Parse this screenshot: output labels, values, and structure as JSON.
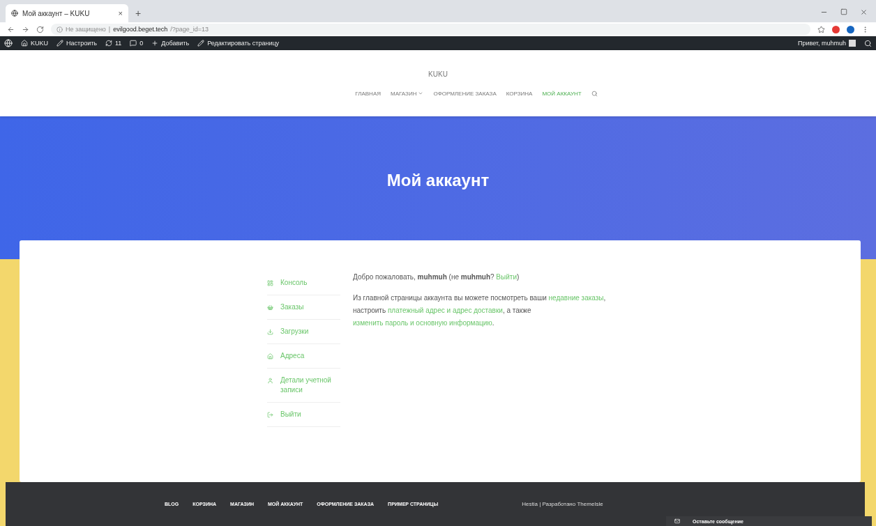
{
  "browser": {
    "tab_title": "Мой аккаунт – KUKU",
    "tab_close": "×",
    "new_tab": "+",
    "url_warning": "Не защищено",
    "url_separator": "|",
    "url_host": "evilgood.beget.tech",
    "url_path": "/?page_id=13"
  },
  "admin_bar": {
    "items": [
      {
        "kind": "site",
        "label": "KUKU"
      },
      {
        "kind": "customize",
        "label": "Настроить"
      },
      {
        "kind": "updates",
        "label": "11"
      },
      {
        "kind": "comments",
        "label": "0"
      },
      {
        "kind": "new",
        "label": "Добавить"
      },
      {
        "kind": "edit",
        "label": "Редактировать страницу"
      }
    ],
    "greeting": "Привет, muhmuh"
  },
  "site_title": "KUKU",
  "nav": [
    {
      "label": "ГЛАВНАЯ",
      "selected": false,
      "dropdown": false
    },
    {
      "label": "МАГАЗИН",
      "selected": false,
      "dropdown": true
    },
    {
      "label": "ОФОРМЛЕНИЕ ЗАКАЗА",
      "selected": false,
      "dropdown": false
    },
    {
      "label": "КОРЗИНА",
      "selected": false,
      "dropdown": false
    },
    {
      "label": "МОЙ АККАУНТ",
      "selected": true,
      "dropdown": false
    }
  ],
  "hero_title": "Мой аккаунт",
  "account_menu": [
    {
      "kind": "dashboard",
      "label": "Консоль"
    },
    {
      "kind": "orders",
      "label": "Заказы"
    },
    {
      "kind": "downloads",
      "label": "Загрузки"
    },
    {
      "kind": "addresses",
      "label": "Адреса"
    },
    {
      "kind": "account",
      "label": "Детали учетной записи"
    },
    {
      "kind": "logout",
      "label": "Выйти"
    }
  ],
  "welcome": [
    {
      "text": "Добро пожаловать, "
    },
    {
      "text": "muhmuh",
      "bold": true
    },
    {
      "text": " (не "
    },
    {
      "text": "muhmuh",
      "bold": true
    },
    {
      "text": "? "
    },
    {
      "text": "Выйти",
      "link": true
    },
    {
      "text": ")"
    }
  ],
  "intro": [
    {
      "text": "Из главной страницы аккаунта вы можете посмотреть ваши "
    },
    {
      "text": "недавние заказы",
      "link": true
    },
    {
      "text": ", настроить "
    },
    {
      "text": "платежный адрес и адрес доставки",
      "link": true
    },
    {
      "text": ", а также "
    },
    {
      "text": "изменить пароль и основную информацию",
      "link": true
    },
    {
      "text": "."
    }
  ],
  "footer_links": [
    "BLOG",
    "КОРЗИНА",
    "МАГАЗИН",
    "МОЙ АККАУНТ",
    "ОФОРМЛЕНИЕ ЗАКАЗА",
    "ПРИМЕР СТРАНИЦЫ"
  ],
  "footer_credit": "Hestia | Разработано ThemeIsle",
  "chat_button": "Оставьте сообщение"
}
